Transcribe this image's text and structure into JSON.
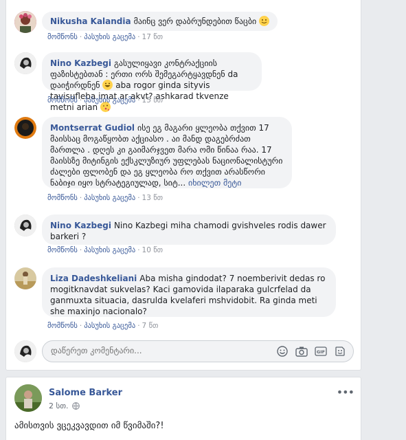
{
  "comments": [
    {
      "author": "Nikusha Kalandia",
      "text": "მაინც ვერ დაბრუნდებით წაცბი",
      "like": "მომწონს",
      "reply": "პასუხის გაცემა",
      "time": "17 წთ"
    },
    {
      "author": "Nino Kazbegi",
      "text_a": "გასულიყავი კონტრაქციის ფაზისტებთან : ერთი ორს შემეგარტყავდნენ da დაიჭირდნენ",
      "text_b": "aba rogor ginda sityvis tavisufleba imat ar akvt? ashkarad tkvenze metni arian",
      "like": "მომწონს",
      "reply": "პასუხის გაცემა",
      "time": "15 წთ"
    },
    {
      "author": "Montserrat Gudiol",
      "text": "ისე ეგ მაგარი ყლეობა თქვით 17 მაისსაც მოგაწყობთ აქციასო . აი მანდ დაგებრძათ მართლა . დღეს კი გაიმარჯვეთ მარა ომი წინაა რაა. 17 მაისსზე მიტინგის ექსკლუზიურ უფლებას ნაციონალისტური ძალები ფლობენ და ეგ ყლეობა რო თქვით არასწორი ნაბიჯი იყო სტრატეგიულად, სიტ...",
      "see_more": "იხილეთ მეტი",
      "like": "მომწონს",
      "reply": "პასუხის გაცემა",
      "time": "13 წთ"
    },
    {
      "author": "Nino Kazbegi",
      "text": "Nino Kazbegi miha chamodi gvishveles rodis dawer barkeri ?",
      "like": "მომწონს",
      "reply": "პასუხის გაცემა",
      "time": "10 წთ"
    },
    {
      "author": "Liza Dadeshkeliani",
      "text": "Aba misha gindodat? 7 noemberivit dedas ro mogitknavdat sukvelas? Kaci gamovida ilaparaka gulcrfelad da ganmuxta situacia, dasrulda kvelaferi mshvidobit. Ra ginda meti she maxinjo nacionalo?",
      "like": "მომწონს",
      "reply": "პასუხის გაცემა",
      "time": "7 წთ"
    }
  ],
  "composer": {
    "placeholder": "დაწერეთ კომენტარი..."
  },
  "post": {
    "author": "Salome Barker",
    "time": "2 სთ.",
    "text": "ამისთვის ვცეკვავდით იმ წვიმაში?!"
  }
}
